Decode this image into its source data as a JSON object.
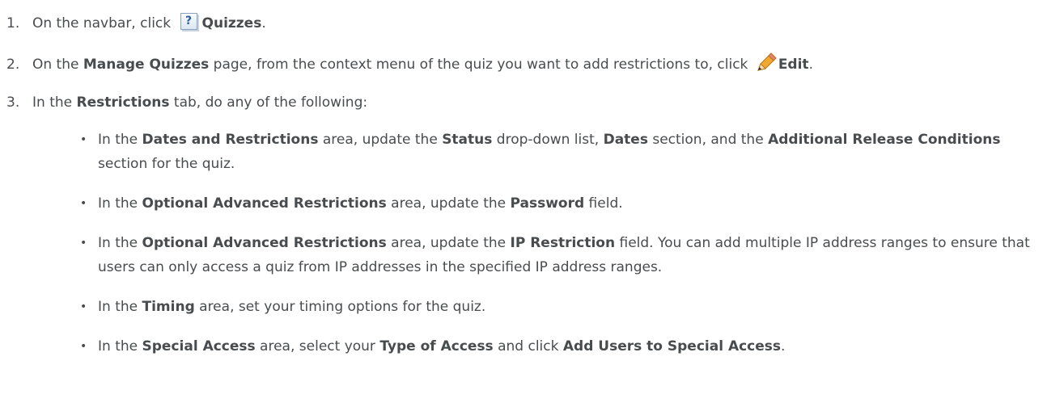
{
  "steps": [
    {
      "num": "1.",
      "pre": "On the navbar, click ",
      "icon": "quiz-icon",
      "b1": "Quizzes",
      "post": "."
    },
    {
      "num": "2.",
      "pre": "On the ",
      "b1": "Manage Quizzes",
      "mid": " page, from the context menu of the quiz you want to add restrictions to, click ",
      "icon": "pencil-edit-icon",
      "b2": "Edit",
      "post": "."
    },
    {
      "num": "3.",
      "pre": "In the ",
      "b1": "Restrictions",
      "post": " tab, do any of the following:"
    }
  ],
  "bullets": [
    {
      "t1": "In the ",
      "b1": "Dates and Restrictions",
      "t2": " area, update the ",
      "b2": "Status",
      "t3": " drop-down list, ",
      "b3": "Dates",
      "t4": " section, and the ",
      "b4": "Additional Release Conditions",
      "t5": " section for the quiz."
    },
    {
      "t1": "In the ",
      "b1": "Optional Advanced Restrictions",
      "t2": " area, update the ",
      "b2": "Password",
      "t3": " field."
    },
    {
      "t1": "In the ",
      "b1": "Optional Advanced Restrictions",
      "t2": " area, update the ",
      "b2": "IP Restriction",
      "t3": " field. You can add multiple IP address ranges to ensure that users can only access a quiz from IP addresses in the specified IP address ranges."
    },
    {
      "t1": "In the ",
      "b1": "Timing",
      "t2": " area, set your timing options for the quiz."
    },
    {
      "t1": "In the ",
      "b1": "Special Access",
      "t2": " area, select your ",
      "b2": "Type of Access",
      "t3": " and click ",
      "b3": "Add Users to Special Access",
      "t4": "."
    }
  ],
  "icons": {
    "quiz_glyph": "?",
    "bullet_glyph": "•"
  },
  "colors": {
    "text": "#494c4e",
    "icon_border": "#8aa2bd",
    "pencil": "#f0a830"
  }
}
